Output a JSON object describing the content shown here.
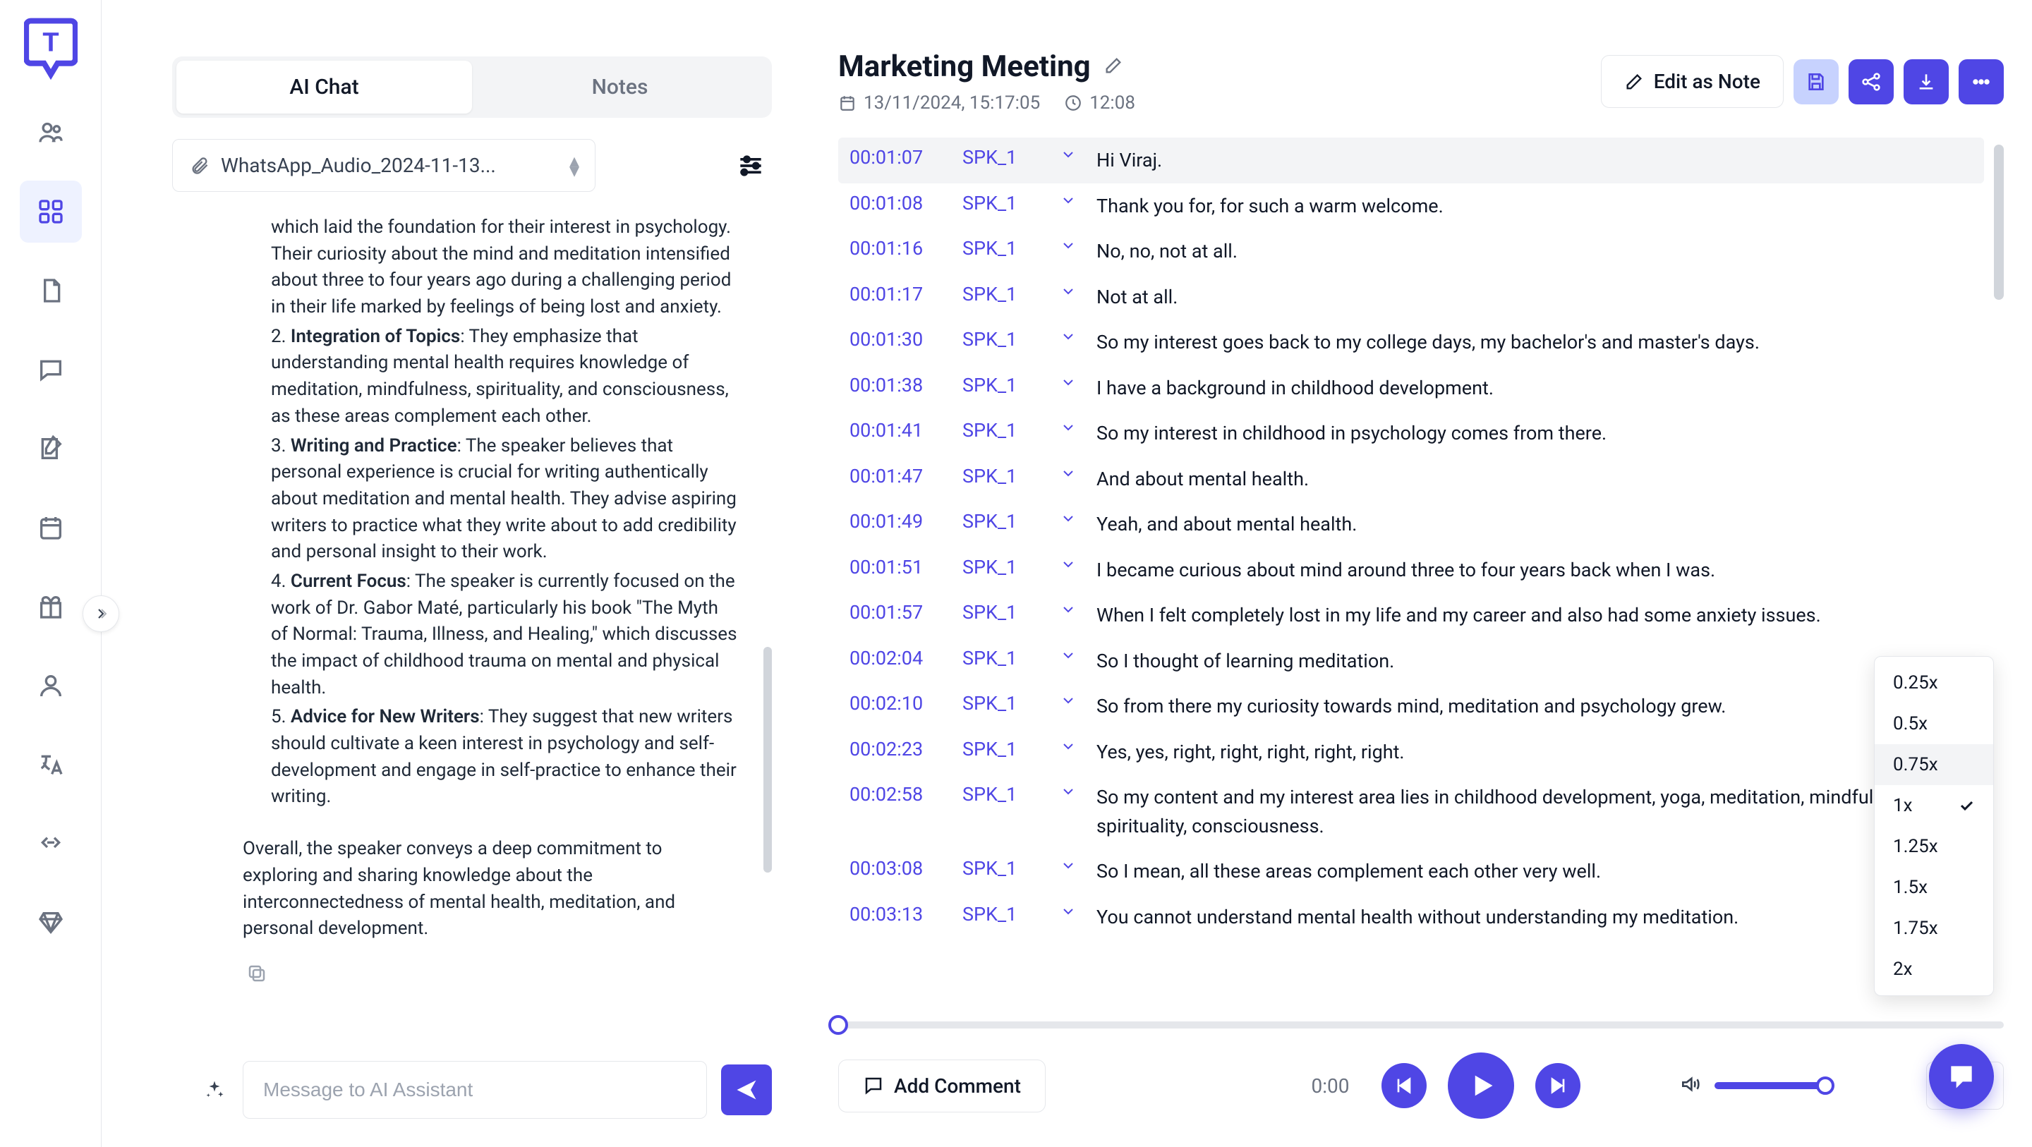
{
  "sidebar": {
    "items": [
      "people",
      "dashboard",
      "document",
      "chat",
      "note-edit",
      "calendar",
      "gift",
      "user",
      "language",
      "connect",
      "diamond"
    ]
  },
  "leftPanel": {
    "tabs": {
      "chat": "AI Chat",
      "notes": "Notes"
    },
    "file": "WhatsApp_Audio_2024-11-13...",
    "chat": {
      "item1_prefix": "which laid the foundation for their interest in psychology. Their curiosity about the mind and meditation intensified about three to four years ago during a challenging period in their life marked by feelings of being lost and anxiety.",
      "item2_title": "Integration of Topics",
      "item2_body": ": They emphasize that understanding mental health requires knowledge of meditation, mindfulness, spirituality, and consciousness, as these areas complement each other.",
      "item3_title": "Writing and Practice",
      "item3_body": ": The speaker believes that personal experience is crucial for writing authentically about meditation and mental health. They advise aspiring writers to practice what they write about to add credibility and personal insight to their work.",
      "item4_title": "Current Focus",
      "item4_body": ": The speaker is currently focused on the work of Dr. Gabor Maté, particularly his book \"The Myth of Normal: Trauma, Illness, and Healing,\" which discusses the impact of childhood trauma on mental and physical health.",
      "item5_title": "Advice for New Writers",
      "item5_body": ": They suggest that new writers should cultivate a keen interest in psychology and self-development and engage in self-practice to enhance their writing.",
      "summary": "Overall, the speaker conveys a deep commitment to exploring and sharing knowledge about the interconnectedness of mental health, meditation, and personal development."
    },
    "inputPlaceholder": "Message to AI Assistant"
  },
  "header": {
    "title": "Marketing Meeting",
    "date": "13/11/2024, 15:17:05",
    "duration": "12:08",
    "editAsNote": "Edit as Note"
  },
  "transcript": [
    {
      "time": "00:01:07",
      "speaker": "SPK_1",
      "text": "Hi Viraj.",
      "highlight": true
    },
    {
      "time": "00:01:08",
      "speaker": "SPK_1",
      "text": "Thank you for, for such a warm welcome."
    },
    {
      "time": "00:01:16",
      "speaker": "SPK_1",
      "text": "No, no, not at all."
    },
    {
      "time": "00:01:17",
      "speaker": "SPK_1",
      "text": "Not at all."
    },
    {
      "time": "00:01:30",
      "speaker": "SPK_1",
      "text": "So my interest goes back to my college days, my bachelor's and master's days."
    },
    {
      "time": "00:01:38",
      "speaker": "SPK_1",
      "text": "I have a background in childhood development."
    },
    {
      "time": "00:01:41",
      "speaker": "SPK_1",
      "text": "So my interest in childhood in psychology comes from there."
    },
    {
      "time": "00:01:47",
      "speaker": "SPK_1",
      "text": "And about mental health."
    },
    {
      "time": "00:01:49",
      "speaker": "SPK_1",
      "text": "Yeah, and about mental health."
    },
    {
      "time": "00:01:51",
      "speaker": "SPK_1",
      "text": "I became curious about mind around three to four years back when I was."
    },
    {
      "time": "00:01:57",
      "speaker": "SPK_1",
      "text": "When I felt completely lost in my life and my career and also had some anxiety issues."
    },
    {
      "time": "00:02:04",
      "speaker": "SPK_1",
      "text": "So I thought of learning meditation."
    },
    {
      "time": "00:02:10",
      "speaker": "SPK_1",
      "text": "So from there my curiosity towards mind, meditation and psychology grew."
    },
    {
      "time": "00:02:23",
      "speaker": "SPK_1",
      "text": "Yes, yes, right, right, right, right, right."
    },
    {
      "time": "00:02:58",
      "speaker": "SPK_1",
      "text": "So my content and my interest area lies in childhood development, yoga, meditation, mindfulness, spirituality, consciousness."
    },
    {
      "time": "00:03:08",
      "speaker": "SPK_1",
      "text": "So I mean, all these areas complement each other very well."
    },
    {
      "time": "00:03:13",
      "speaker": "SPK_1",
      "text": "You cannot understand mental health without understanding my meditation."
    }
  ],
  "speedMenu": {
    "options": [
      "0.25x",
      "0.5x",
      "0.75x",
      "1x",
      "1.25x",
      "1.5x",
      "1.75x",
      "2x"
    ],
    "selected": "1x",
    "hovered": "0.75x"
  },
  "playback": {
    "currentTime": "0:00",
    "addComment": "Add Comment",
    "speed": "1x"
  }
}
